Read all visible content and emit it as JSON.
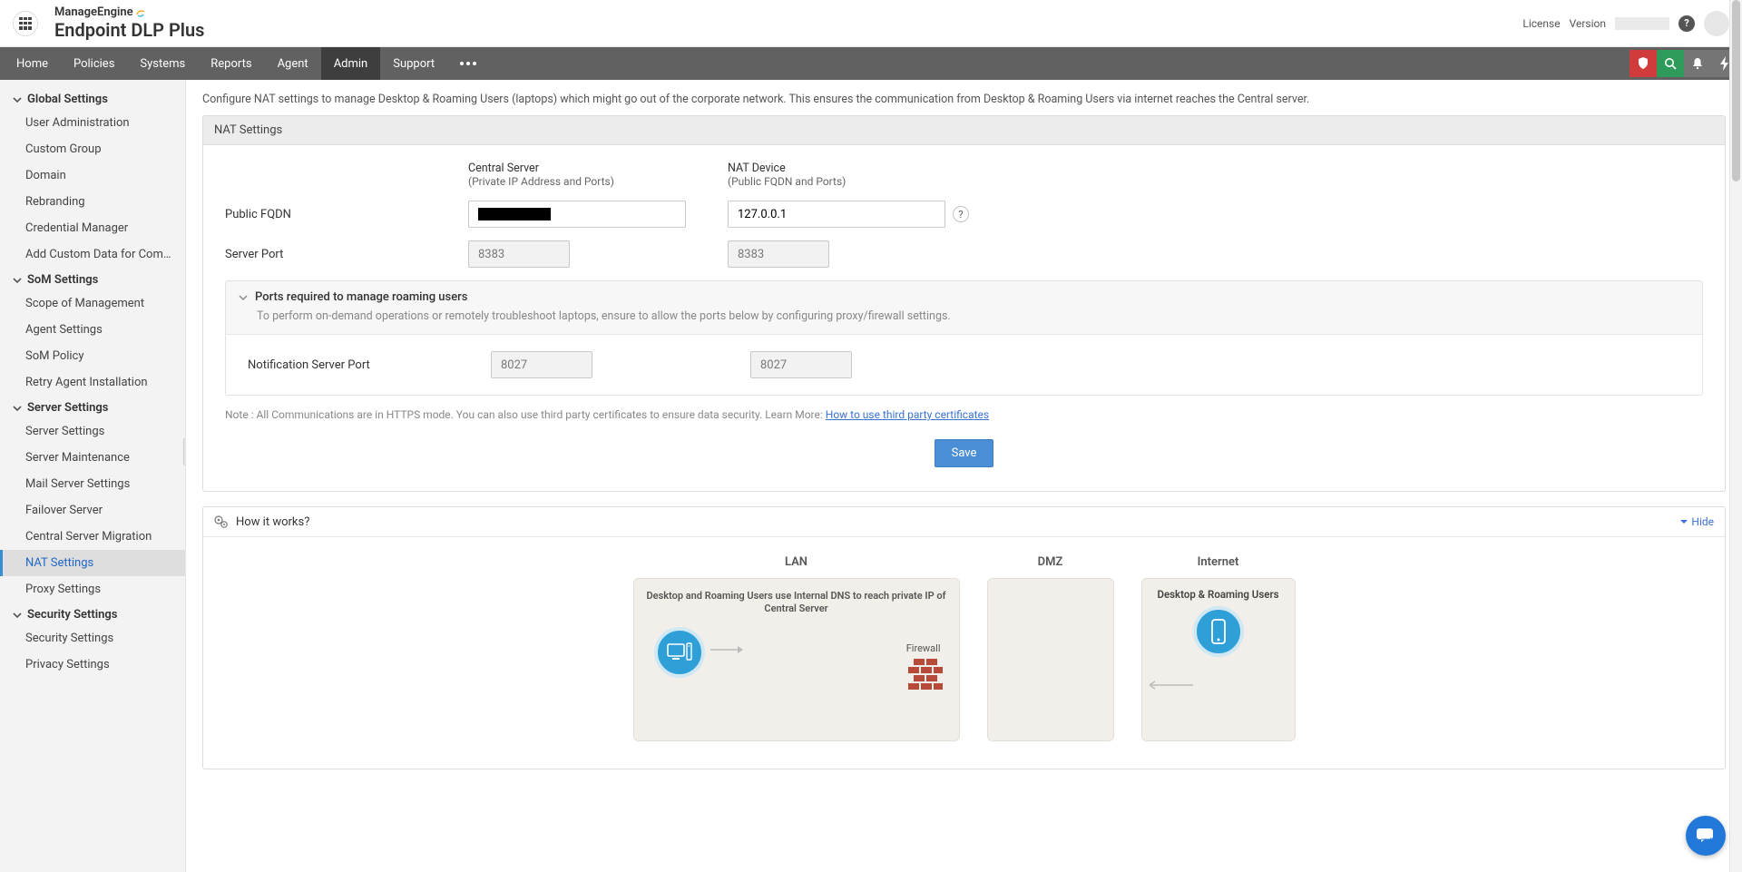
{
  "brand": {
    "top": "ManageEngine",
    "main": "Endpoint DLP Plus"
  },
  "topbar": {
    "license": "License",
    "version": "Version"
  },
  "nav": {
    "items": [
      "Home",
      "Policies",
      "Systems",
      "Reports",
      "Agent",
      "Admin",
      "Support"
    ],
    "active": "Admin"
  },
  "sidebar": {
    "sections": [
      {
        "title": "Global Settings",
        "items": [
          "User Administration",
          "Custom Group",
          "Domain",
          "Rebranding",
          "Credential Manager",
          "Add Custom Data for Comput..."
        ]
      },
      {
        "title": "SoM Settings",
        "items": [
          "Scope of Management",
          "Agent Settings",
          "SoM Policy",
          "Retry Agent Installation"
        ]
      },
      {
        "title": "Server Settings",
        "items": [
          "Server Settings",
          "Server Maintenance",
          "Mail Server Settings",
          "Failover Server",
          "Central Server Migration",
          "NAT Settings",
          "Proxy Settings"
        ]
      },
      {
        "title": "Security Settings",
        "items": [
          "Security Settings",
          "Privacy Settings"
        ]
      }
    ],
    "active": "NAT Settings"
  },
  "page": {
    "intro": "Configure NAT settings to manage Desktop & Roaming Users (laptops) which might go out of the corporate network. This ensures the communication from Desktop & Roaming Users via internet reaches the Central server.",
    "panel_title": "NAT Settings",
    "col1_title": "Central Server",
    "col1_sub": "(Private IP Address and Ports)",
    "col2_title": "NAT Device",
    "col2_sub": "(Public FQDN and Ports)",
    "rows": {
      "fqdn_label": "Public FQDN",
      "fqdn_nat": "127.0.0.1",
      "port_label": "Server Port",
      "port_central": "8383",
      "port_nat": "8383"
    },
    "ports_section": {
      "title": "Ports required to manage roaming users",
      "desc": "To perform on-demand operations or remotely troubleshoot laptops, ensure to allow the ports below by configuring proxy/firewall settings.",
      "notif_label": "Notification Server Port",
      "notif_central": "8027",
      "notif_nat": "8027"
    },
    "note_prefix": "Note : All Communications are in HTTPS mode. You can also use third party certificates to ensure data security. Learn More: ",
    "note_link": "How to use third party certificates",
    "save": "Save",
    "howit_title": "How it works?",
    "hide": "Hide",
    "diagram": {
      "lan": "LAN",
      "dmz": "DMZ",
      "internet": "Internet",
      "lan_text": "Desktop and Roaming Users use Internal DNS to reach private IP of Central Server",
      "firewall": "Firewall",
      "net_text": "Desktop & Roaming Users"
    }
  }
}
